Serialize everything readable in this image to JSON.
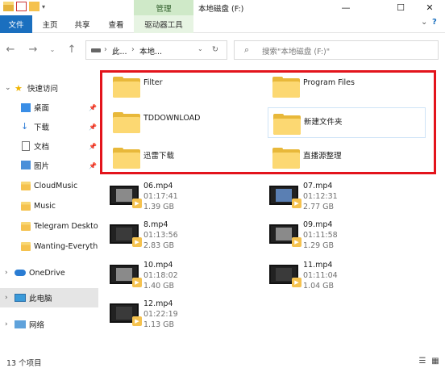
{
  "window": {
    "title": "本地磁盘 (F:)",
    "contextual_group": "管理",
    "controls": {
      "minimize": "—",
      "maximize": "☐",
      "close": "✕"
    }
  },
  "ribbon": {
    "tabs": [
      "文件",
      "主页",
      "共享",
      "查看",
      "驱动器工具"
    ]
  },
  "address": {
    "crumbs": [
      "此...",
      "本地..."
    ],
    "search_placeholder": "搜索\"本地磁盘 (F:)\""
  },
  "nav": {
    "quick_access": "快速访问",
    "items": [
      "桌面",
      "下载",
      "文档",
      "图片",
      "CloudMusic",
      "Music",
      "Telegram Deskto",
      "Wanting-Everythi"
    ],
    "onedrive": "OneDrive",
    "this_pc": "此电脑",
    "network": "网络"
  },
  "folders": [
    "Filter",
    "Program Files",
    "TDDOWNLOAD",
    "新建文件夹",
    "迅雷下载",
    "直播源整理"
  ],
  "videos": [
    {
      "name": "06.mp4",
      "duration": "01:17:41",
      "size": "1.39 GB"
    },
    {
      "name": "07.mp4",
      "duration": "01:12:31",
      "size": "2.77 GB"
    },
    {
      "name": "8.mp4",
      "duration": "01:13:56",
      "size": "2.83 GB"
    },
    {
      "name": "09.mp4",
      "duration": "01:11:58",
      "size": "1.29 GB"
    },
    {
      "name": "10.mp4",
      "duration": "01:18:02",
      "size": "1.40 GB"
    },
    {
      "name": "11.mp4",
      "duration": "01:11:04",
      "size": "1.04 GB"
    },
    {
      "name": "12.mp4",
      "duration": "01:22:19",
      "size": "1.13 GB"
    }
  ],
  "status": {
    "count": "13 个项目"
  },
  "colors": {
    "highlight_box": "#e3141c",
    "file_tab": "#1a6fbf",
    "manage_tab": "#cfe9c8"
  }
}
